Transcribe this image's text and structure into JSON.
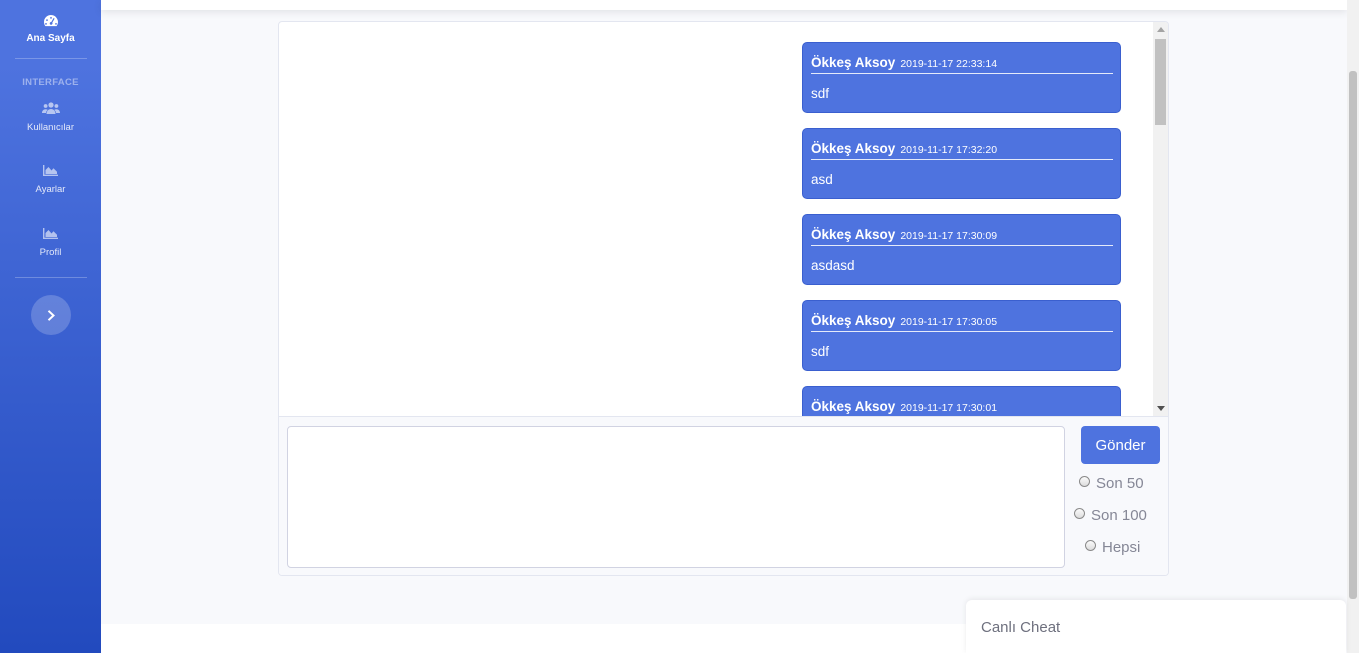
{
  "sidebar": {
    "brand": {
      "icon": "dashboard-gauge-icon",
      "label": "Ana Sayfa"
    },
    "heading": "INTERFACE",
    "items": [
      {
        "icon": "users-icon",
        "label": "Kullanıcılar"
      },
      {
        "icon": "area-chart-icon",
        "label": "Ayarlar"
      },
      {
        "icon": "area-chart-icon",
        "label": "Profil"
      }
    ],
    "toggle_icon": "chevron-right-icon"
  },
  "chat": {
    "messages": [
      {
        "author": "Ökkeş Aksoy",
        "time": "2019-11-17 22:33:14",
        "text": "sdf"
      },
      {
        "author": "Ökkeş Aksoy",
        "time": "2019-11-17 17:32:20",
        "text": "asd"
      },
      {
        "author": "Ökkeş Aksoy",
        "time": "2019-11-17 17:30:09",
        "text": "asdasd"
      },
      {
        "author": "Ökkeş Aksoy",
        "time": "2019-11-17 17:30:05",
        "text": "sdf"
      },
      {
        "author": "Ökkeş Aksoy",
        "time": "2019-11-17 17:30:01",
        "text": ""
      }
    ],
    "input_value": "",
    "send_label": "Gönder",
    "options": [
      "Son 50",
      "Son 100",
      "Hepsi"
    ]
  },
  "live_chat": {
    "label": "Canlı Cheat"
  },
  "colors": {
    "primary": "#4e73df",
    "sidebar_bottom": "#224abe",
    "page_bg": "#f8f9fc"
  }
}
